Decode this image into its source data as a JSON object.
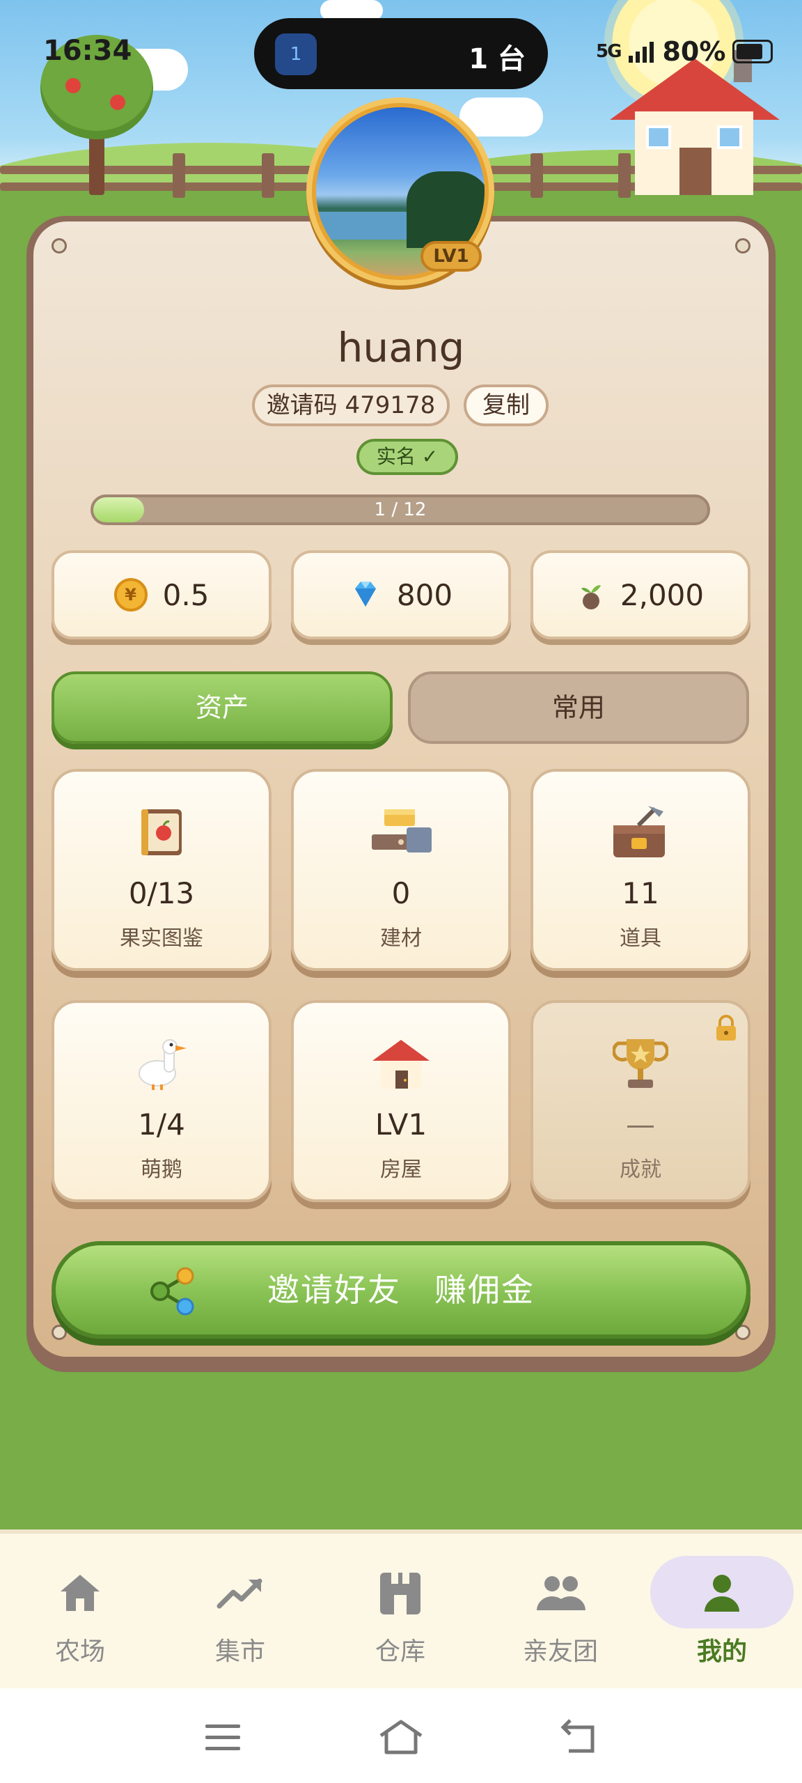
{
  "status_bar": {
    "time": "16:34",
    "island_icon": "1",
    "island_text": "1 台",
    "network": "5G",
    "battery": "80%"
  },
  "profile": {
    "username": "huang",
    "level_badge": "LV1",
    "invite_code_text": "邀请码 479178",
    "copy_label": "复制",
    "verified_label": "实名 ✓",
    "progress_text": "1 / 12",
    "progress_fraction": 0.083
  },
  "currencies": [
    {
      "icon": "coin-icon",
      "symbol": "¥",
      "value": "0.5"
    },
    {
      "icon": "diamond-icon",
      "value": "800"
    },
    {
      "icon": "seed-icon",
      "value": "2,000"
    }
  ],
  "tabs": [
    {
      "label": "资产",
      "active": true
    },
    {
      "label": "常用",
      "active": false
    }
  ],
  "cards": [
    {
      "icon": "fruit-book-icon",
      "value": "0/13",
      "label": "果实图鉴",
      "locked": false
    },
    {
      "icon": "building-materials-icon",
      "value": "0",
      "label": "建材",
      "locked": false
    },
    {
      "icon": "toolbox-icon",
      "value": "11",
      "label": "道具",
      "locked": false
    },
    {
      "icon": "goose-icon",
      "value": "1/4",
      "label": "萌鹅",
      "locked": false
    },
    {
      "icon": "house-icon",
      "value": "LV1",
      "label": "房屋",
      "locked": false
    },
    {
      "icon": "trophy-icon",
      "value": "—",
      "label": "成就",
      "locked": true
    }
  ],
  "invite_button": {
    "icon": "share-icon",
    "label": "邀请好友　赚佣金"
  },
  "bottom_nav": [
    {
      "icon": "home-icon",
      "label": "农场",
      "active": false
    },
    {
      "icon": "trend-icon",
      "label": "集市",
      "active": false
    },
    {
      "icon": "warehouse-icon",
      "label": "仓库",
      "active": false
    },
    {
      "icon": "friends-icon",
      "label": "亲友团",
      "active": false
    },
    {
      "icon": "person-icon",
      "label": "我的",
      "active": true
    }
  ],
  "system_nav": [
    "menu-icon",
    "home-icon",
    "back-icon"
  ],
  "colors": {
    "accent_green": "#76b044",
    "panel_brown": "#8d6a5a",
    "nav_active": "#4a7a22",
    "nav_inactive": "#8a8a8a"
  }
}
